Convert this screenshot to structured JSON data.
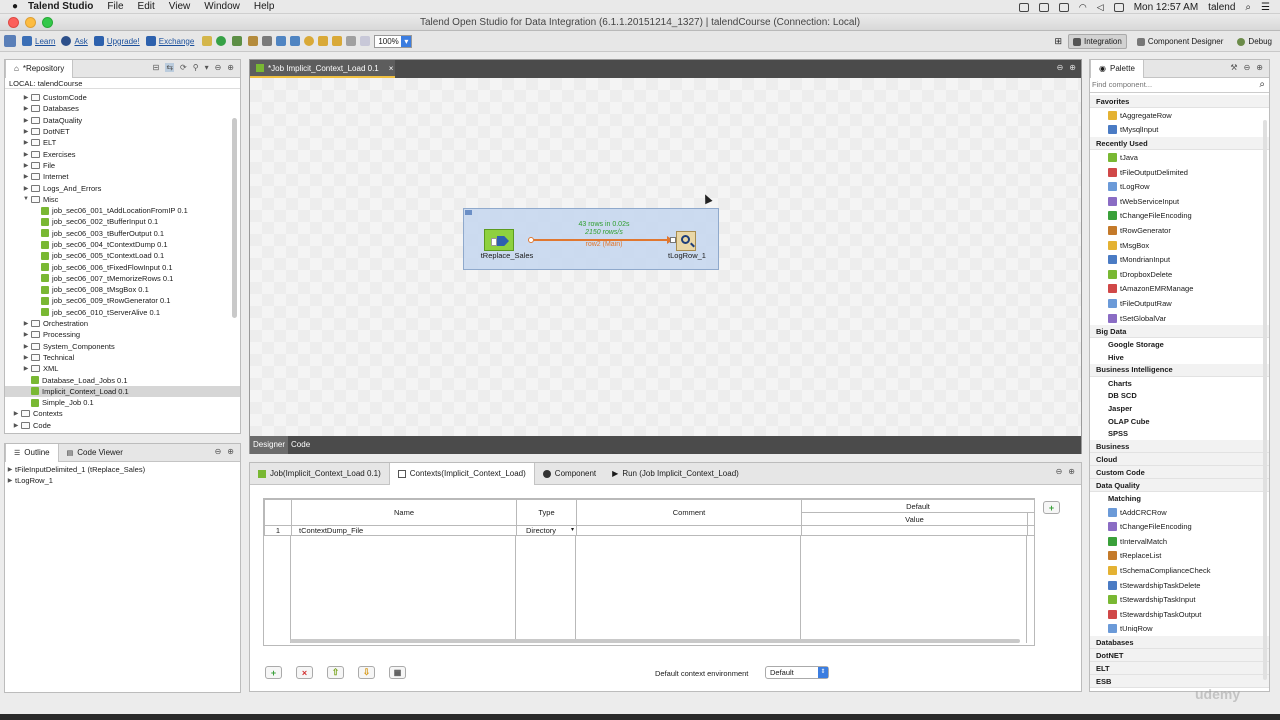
{
  "menubar": {
    "app_name": "Talend Studio",
    "menus": [
      "File",
      "Edit",
      "View",
      "Window",
      "Help"
    ],
    "clock": "Mon 12:57 AM",
    "user": "talend"
  },
  "window": {
    "title": "Talend Open Studio for Data Integration (6.1.1.20151214_1327) | talendCourse (Connection: Local)"
  },
  "toolbar": {
    "learn": "Learn",
    "ask": "Ask",
    "upgrade": "Upgrade!",
    "exchange": "Exchange",
    "zoom": "100%"
  },
  "perspectives": {
    "integration": "Integration",
    "component_designer": "Component Designer",
    "debug": "Debug"
  },
  "repository": {
    "tab": "*Repository",
    "project": "LOCAL: talendCourse",
    "items": [
      {
        "label": "CustomCode",
        "kind": "folder",
        "indent": 1,
        "toggle": "▶"
      },
      {
        "label": "Databases",
        "kind": "folder",
        "indent": 1,
        "toggle": "▶"
      },
      {
        "label": "DataQuality",
        "kind": "folder",
        "indent": 1,
        "toggle": "▶"
      },
      {
        "label": "DotNET",
        "kind": "folder",
        "indent": 1,
        "toggle": "▶"
      },
      {
        "label": "ELT",
        "kind": "folder",
        "indent": 1,
        "toggle": "▶"
      },
      {
        "label": "Exercises",
        "kind": "folder",
        "indent": 1,
        "toggle": "▶"
      },
      {
        "label": "File",
        "kind": "folder",
        "indent": 1,
        "toggle": "▶"
      },
      {
        "label": "Internet",
        "kind": "folder",
        "indent": 1,
        "toggle": "▶"
      },
      {
        "label": "Logs_And_Errors",
        "kind": "folder",
        "indent": 1,
        "toggle": "▶"
      },
      {
        "label": "Misc",
        "kind": "folder",
        "indent": 1,
        "toggle": "▼"
      },
      {
        "label": "job_sec06_001_tAddLocationFromIP 0.1",
        "kind": "job",
        "indent": 2,
        "toggle": ""
      },
      {
        "label": "job_sec06_002_tBufferInput 0.1",
        "kind": "job",
        "indent": 2,
        "toggle": ""
      },
      {
        "label": "job_sec06_003_tBufferOutput 0.1",
        "kind": "job",
        "indent": 2,
        "toggle": ""
      },
      {
        "label": "job_sec06_004_tContextDump 0.1",
        "kind": "job",
        "indent": 2,
        "toggle": ""
      },
      {
        "label": "job_sec06_005_tContextLoad 0.1",
        "kind": "job",
        "indent": 2,
        "toggle": ""
      },
      {
        "label": "job_sec06_006_tFixedFlowInput 0.1",
        "kind": "job",
        "indent": 2,
        "toggle": ""
      },
      {
        "label": "job_sec06_007_tMemorizeRows 0.1",
        "kind": "job",
        "indent": 2,
        "toggle": ""
      },
      {
        "label": "job_sec06_008_tMsgBox 0.1",
        "kind": "job",
        "indent": 2,
        "toggle": ""
      },
      {
        "label": "job_sec06_009_tRowGenerator 0.1",
        "kind": "job",
        "indent": 2,
        "toggle": ""
      },
      {
        "label": "job_sec06_010_tServerAlive 0.1",
        "kind": "job",
        "indent": 2,
        "toggle": ""
      },
      {
        "label": "Orchestration",
        "kind": "folder",
        "indent": 1,
        "toggle": "▶"
      },
      {
        "label": "Processing",
        "kind": "folder",
        "indent": 1,
        "toggle": "▶"
      },
      {
        "label": "System_Components",
        "kind": "folder",
        "indent": 1,
        "toggle": "▶"
      },
      {
        "label": "Technical",
        "kind": "folder",
        "indent": 1,
        "toggle": "▶"
      },
      {
        "label": "XML",
        "kind": "folder",
        "indent": 1,
        "toggle": "▶"
      },
      {
        "label": "Database_Load_Jobs 0.1",
        "kind": "job",
        "indent": 1,
        "toggle": ""
      },
      {
        "label": "Implicit_Context_Load 0.1",
        "kind": "job",
        "indent": 1,
        "toggle": "",
        "selected": true
      },
      {
        "label": "Simple_Job 0.1",
        "kind": "job",
        "indent": 1,
        "toggle": ""
      },
      {
        "label": "Contexts",
        "kind": "folder",
        "indent": 0,
        "toggle": "▶"
      },
      {
        "label": "Code",
        "kind": "folder",
        "indent": 0,
        "toggle": "▶"
      }
    ]
  },
  "outline": {
    "tab_outline": "Outline",
    "tab_code_viewer": "Code Viewer",
    "items": [
      "tFileInputDelimited_1 (tReplace_Sales)",
      "tLogRow_1"
    ]
  },
  "editor": {
    "tab": "*Job Implicit_Context_Load 0.1",
    "bottom_tabs": [
      "Designer",
      "Code"
    ],
    "job": {
      "source": "tReplace_Sales",
      "target": "tLogRow_1",
      "rows_stat": "43 rows in 0.02s",
      "rate_stat": "2150 rows/s",
      "link_label": "row2 (Main)"
    }
  },
  "bottom_panel": {
    "tabs": [
      "Job(Implicit_Context_Load 0.1)",
      "Contexts(Implicit_Context_Load)",
      "Component",
      "Run (Job Implicit_Context_Load)"
    ],
    "table": {
      "col_name": "Name",
      "col_type": "Type",
      "col_comment": "Comment",
      "col_default": "Default",
      "col_value": "Value",
      "rows": [
        {
          "index": "1",
          "name": "tContextDump_File",
          "type": "Directory",
          "comment": "",
          "value": ""
        }
      ]
    },
    "default_env_label": "Default context environment",
    "default_env_value": "Default"
  },
  "palette": {
    "tab": "Palette",
    "search_placeholder": "Find component...",
    "favorites_header": "Favorites",
    "favorites": [
      "tAggregateRow",
      "tMysqlInput"
    ],
    "recent_header": "Recently Used",
    "recent": [
      "tJava",
      "tFileOutputDelimited",
      "tLogRow",
      "tWebServiceInput",
      "tChangeFileEncoding",
      "tRowGenerator",
      "tMsgBox",
      "tMondrianInput",
      "tDropboxDelete",
      "tAmazonEMRManage",
      "tFileOutputRaw",
      "tSetGlobalVar"
    ],
    "bigdata_header": "Big Data",
    "bigdata": [
      "Google Storage",
      "Hive"
    ],
    "bi_header": "Business Intelligence",
    "bi": [
      "Charts",
      "DB SCD",
      "Jasper",
      "OLAP Cube",
      "SPSS"
    ],
    "groups_a": [
      "Business",
      "Cloud",
      "Custom Code"
    ],
    "dq_header": "Data Quality",
    "matching_header": "Matching",
    "dq_items": [
      "tAddCRCRow",
      "tChangeFileEncoding",
      "tIntervalMatch",
      "tReplaceList",
      "tSchemaComplianceCheck",
      "tStewardshipTaskDelete",
      "tStewardshipTaskInput",
      "tStewardshipTaskOutput",
      "tUniqRow"
    ],
    "groups_b": [
      "Databases",
      "DotNET",
      "ELT",
      "ESB"
    ]
  },
  "colors": {
    "job_green": "#79b833",
    "link_orange": "#e0772f",
    "stat_green": "#2e9e2e",
    "tab_dark": "#4b4b4b"
  }
}
